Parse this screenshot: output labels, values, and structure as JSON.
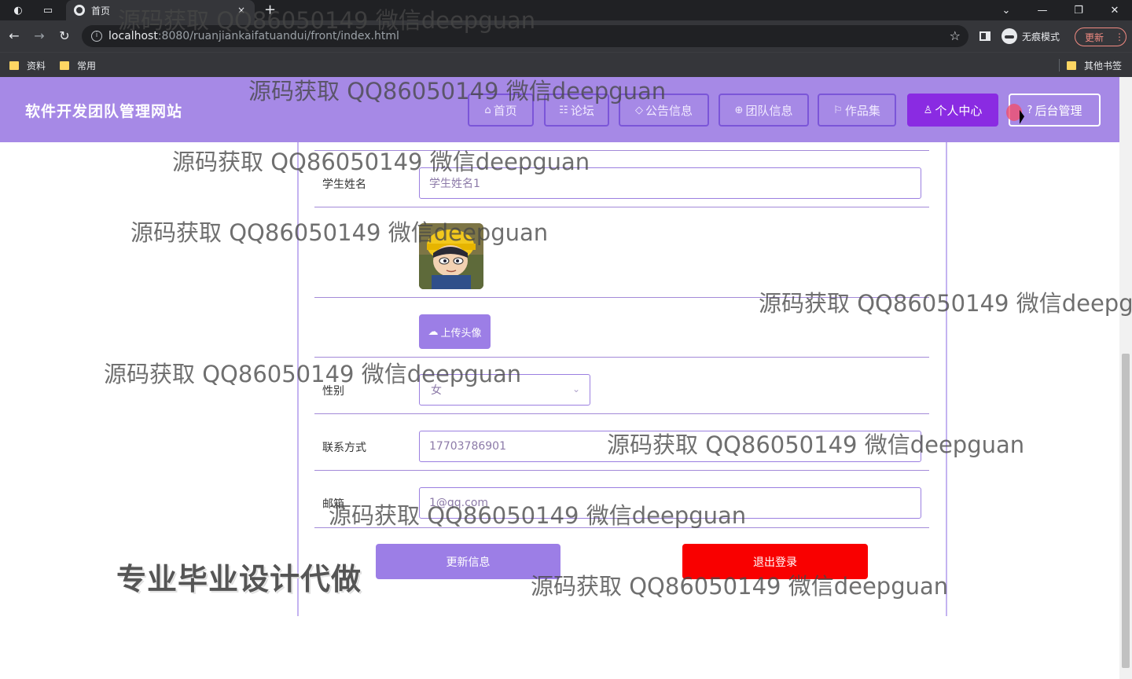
{
  "browser": {
    "tab_title": "首页",
    "tab_close": "×",
    "new_tab": "+",
    "url_host": "localhost",
    "url_path": ":8080/ruanjiankaifatuandui/front/index.html",
    "incognito_label": "无痕模式",
    "update_label": "更新",
    "bookmarks": [
      "资料",
      "常用"
    ],
    "other_bookmarks": "其他书签"
  },
  "site": {
    "title": "软件开发团队管理网站",
    "nav": [
      {
        "label": "首页",
        "icon": "home-icon",
        "glyph": "⌂"
      },
      {
        "label": "论坛",
        "icon": "forum-icon",
        "glyph": "☷"
      },
      {
        "label": "公告信息",
        "icon": "tag-icon",
        "glyph": "◇"
      },
      {
        "label": "团队信息",
        "icon": "globe-icon",
        "glyph": "⊕"
      },
      {
        "label": "作品集",
        "icon": "flag-icon",
        "glyph": "⚐"
      },
      {
        "label": "个人中心",
        "icon": "user-icon",
        "glyph": "♙"
      },
      {
        "label": "后台管理",
        "icon": "help-icon",
        "glyph": "?"
      }
    ],
    "active_nav": "个人中心"
  },
  "form": {
    "student_name_label": "学生姓名",
    "student_name_value": "学生姓名1",
    "upload_label": "上传头像",
    "gender_label": "性别",
    "gender_value": "女",
    "phone_label": "联系方式",
    "phone_value": "17703786901",
    "email_label": "邮箱",
    "email_value": "1@qq.com",
    "update_button": "更新信息",
    "logout_button": "退出登录"
  },
  "watermark": {
    "text": "源码获取 QQ86050149 微信deepguan",
    "big_text": "专业毕业设计代做"
  },
  "colors": {
    "header_bg": "#a689e6",
    "nav_active": "#8a2be2",
    "logout_red": "#f90000",
    "button_purple": "#9c7ee6"
  }
}
